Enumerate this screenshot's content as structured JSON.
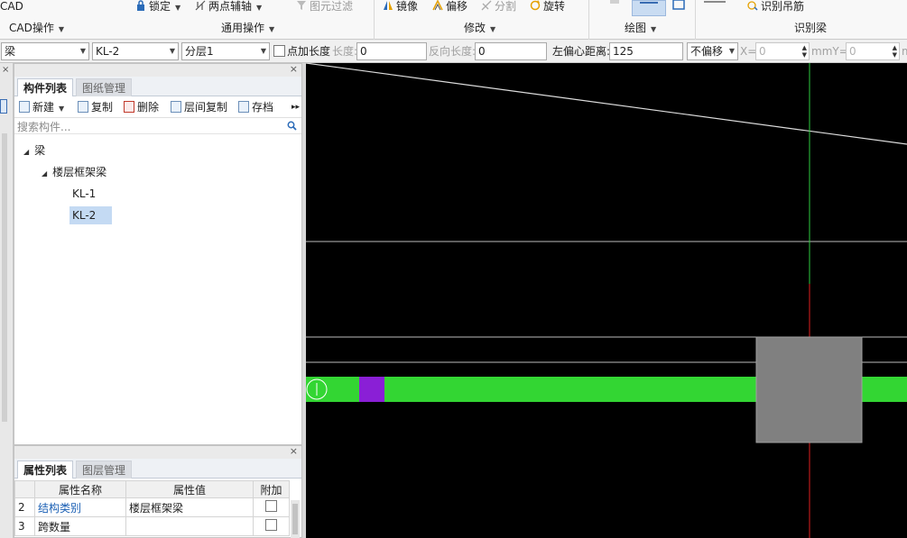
{
  "ribbon": {
    "cad_partial": "CAD",
    "groups": [
      {
        "label": "CAD操作"
      },
      {
        "label": "通用操作"
      },
      {
        "label": "修改"
      },
      {
        "label": "绘图"
      },
      {
        "label": "识别梁"
      }
    ],
    "buttons": {
      "lock": "锁定",
      "two_point_axis": "两点辅轴",
      "element_filter": "图元过滤",
      "mirror": "镜像",
      "offset": "偏移",
      "split": "分割",
      "rotate": "旋转",
      "identify_hanging_rebar": "识别吊筋"
    }
  },
  "toolbar": {
    "element_type": "梁",
    "element_name": "KL-2",
    "layer": "分层1",
    "point_length_label": "点加长度",
    "length_label": "长度:",
    "length_value": "0",
    "reverse_length_label": "反向长度:",
    "reverse_length_value": "0",
    "left_offset_label": "左偏心距离:",
    "left_offset_value": "125",
    "offset_mode": "不偏移",
    "x_label": "X=",
    "x_value": "0",
    "y_label": "mmY=",
    "y_value": "0",
    "trailing_label": "m"
  },
  "component_panel": {
    "tabs": [
      {
        "label": "构件列表",
        "active": true
      },
      {
        "label": "图纸管理",
        "active": false
      }
    ],
    "tools": {
      "new": "新建",
      "copy": "复制",
      "delete": "删除",
      "floor_copy": "层间复制",
      "archive": "存档"
    },
    "search_placeholder": "搜索构件...",
    "tree": {
      "root": "梁",
      "category": "楼层框架梁",
      "items": [
        "KL-1",
        "KL-2"
      ],
      "selected": "KL-2"
    }
  },
  "property_panel": {
    "tabs": [
      {
        "label": "属性列表",
        "active": true
      },
      {
        "label": "图层管理",
        "active": false
      }
    ],
    "columns": [
      "属性名称",
      "属性值",
      "附加"
    ],
    "rows": [
      {
        "num": "2",
        "name": "结构类别",
        "value": "楼层框架梁",
        "extra": false,
        "name_link": true
      },
      {
        "num": "3",
        "name": "跨数量",
        "value": "",
        "extra": false,
        "name_link": false
      }
    ]
  },
  "colors": {
    "canvas_bg": "#000000",
    "beam": "#33d633",
    "marker": "#8a1fd6",
    "column": "#808080",
    "axis_green": "#2ecc40",
    "axis_red": "#e02020",
    "link_blue": "#1a5fb4"
  }
}
